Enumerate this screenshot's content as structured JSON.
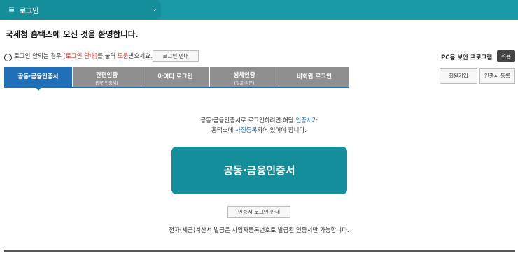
{
  "nav": {
    "breadcrumb": "로그인",
    "menu_icon": "≡",
    "chevron": "⌄"
  },
  "welcome": "국세청 홈택스에 오신 것을 환영합니다.",
  "notice": {
    "pre": "로그인 안되는 경우 ",
    "link": "[로그인 안내]",
    "mid": "를 눌러 ",
    "help": "도움",
    "post": "받으세요.",
    "button": "로그인 안내"
  },
  "security": {
    "label": "PC용 보안 프로그램",
    "apply": "적용"
  },
  "side_buttons": {
    "join": "회원가입",
    "cert_register": "인증서 등록"
  },
  "tabs": [
    {
      "label": "공동·금융인증서",
      "sub": ""
    },
    {
      "label": "간편인증",
      "sub": "(민간인증서)"
    },
    {
      "label": "아이디 로그인",
      "sub": ""
    },
    {
      "label": "생체인증",
      "sub": "(얼굴·지문)"
    },
    {
      "label": "비회원 로그인",
      "sub": ""
    }
  ],
  "desc": {
    "line1_pre": "공동·금융인증서로 로그인하려면 해당 ",
    "line1_link": "인증서",
    "line1_post": "가",
    "line2_pre": "홈택스에 ",
    "line2_link": "사전등록",
    "line2_post": "되어 있어야 합니다."
  },
  "cert_button": "공동·금융인증서",
  "cert_guide": "인증서 로그인 안내",
  "bottom_note": "전자(세금)계산서 발급은 사업자등록번호로 발급된 인증서만 가능합니다.",
  "colors": {
    "teal": "#138e9a",
    "tab_active": "#1f6fb8",
    "tab_inactive": "#8f8f8f",
    "red": "#e4281f"
  }
}
